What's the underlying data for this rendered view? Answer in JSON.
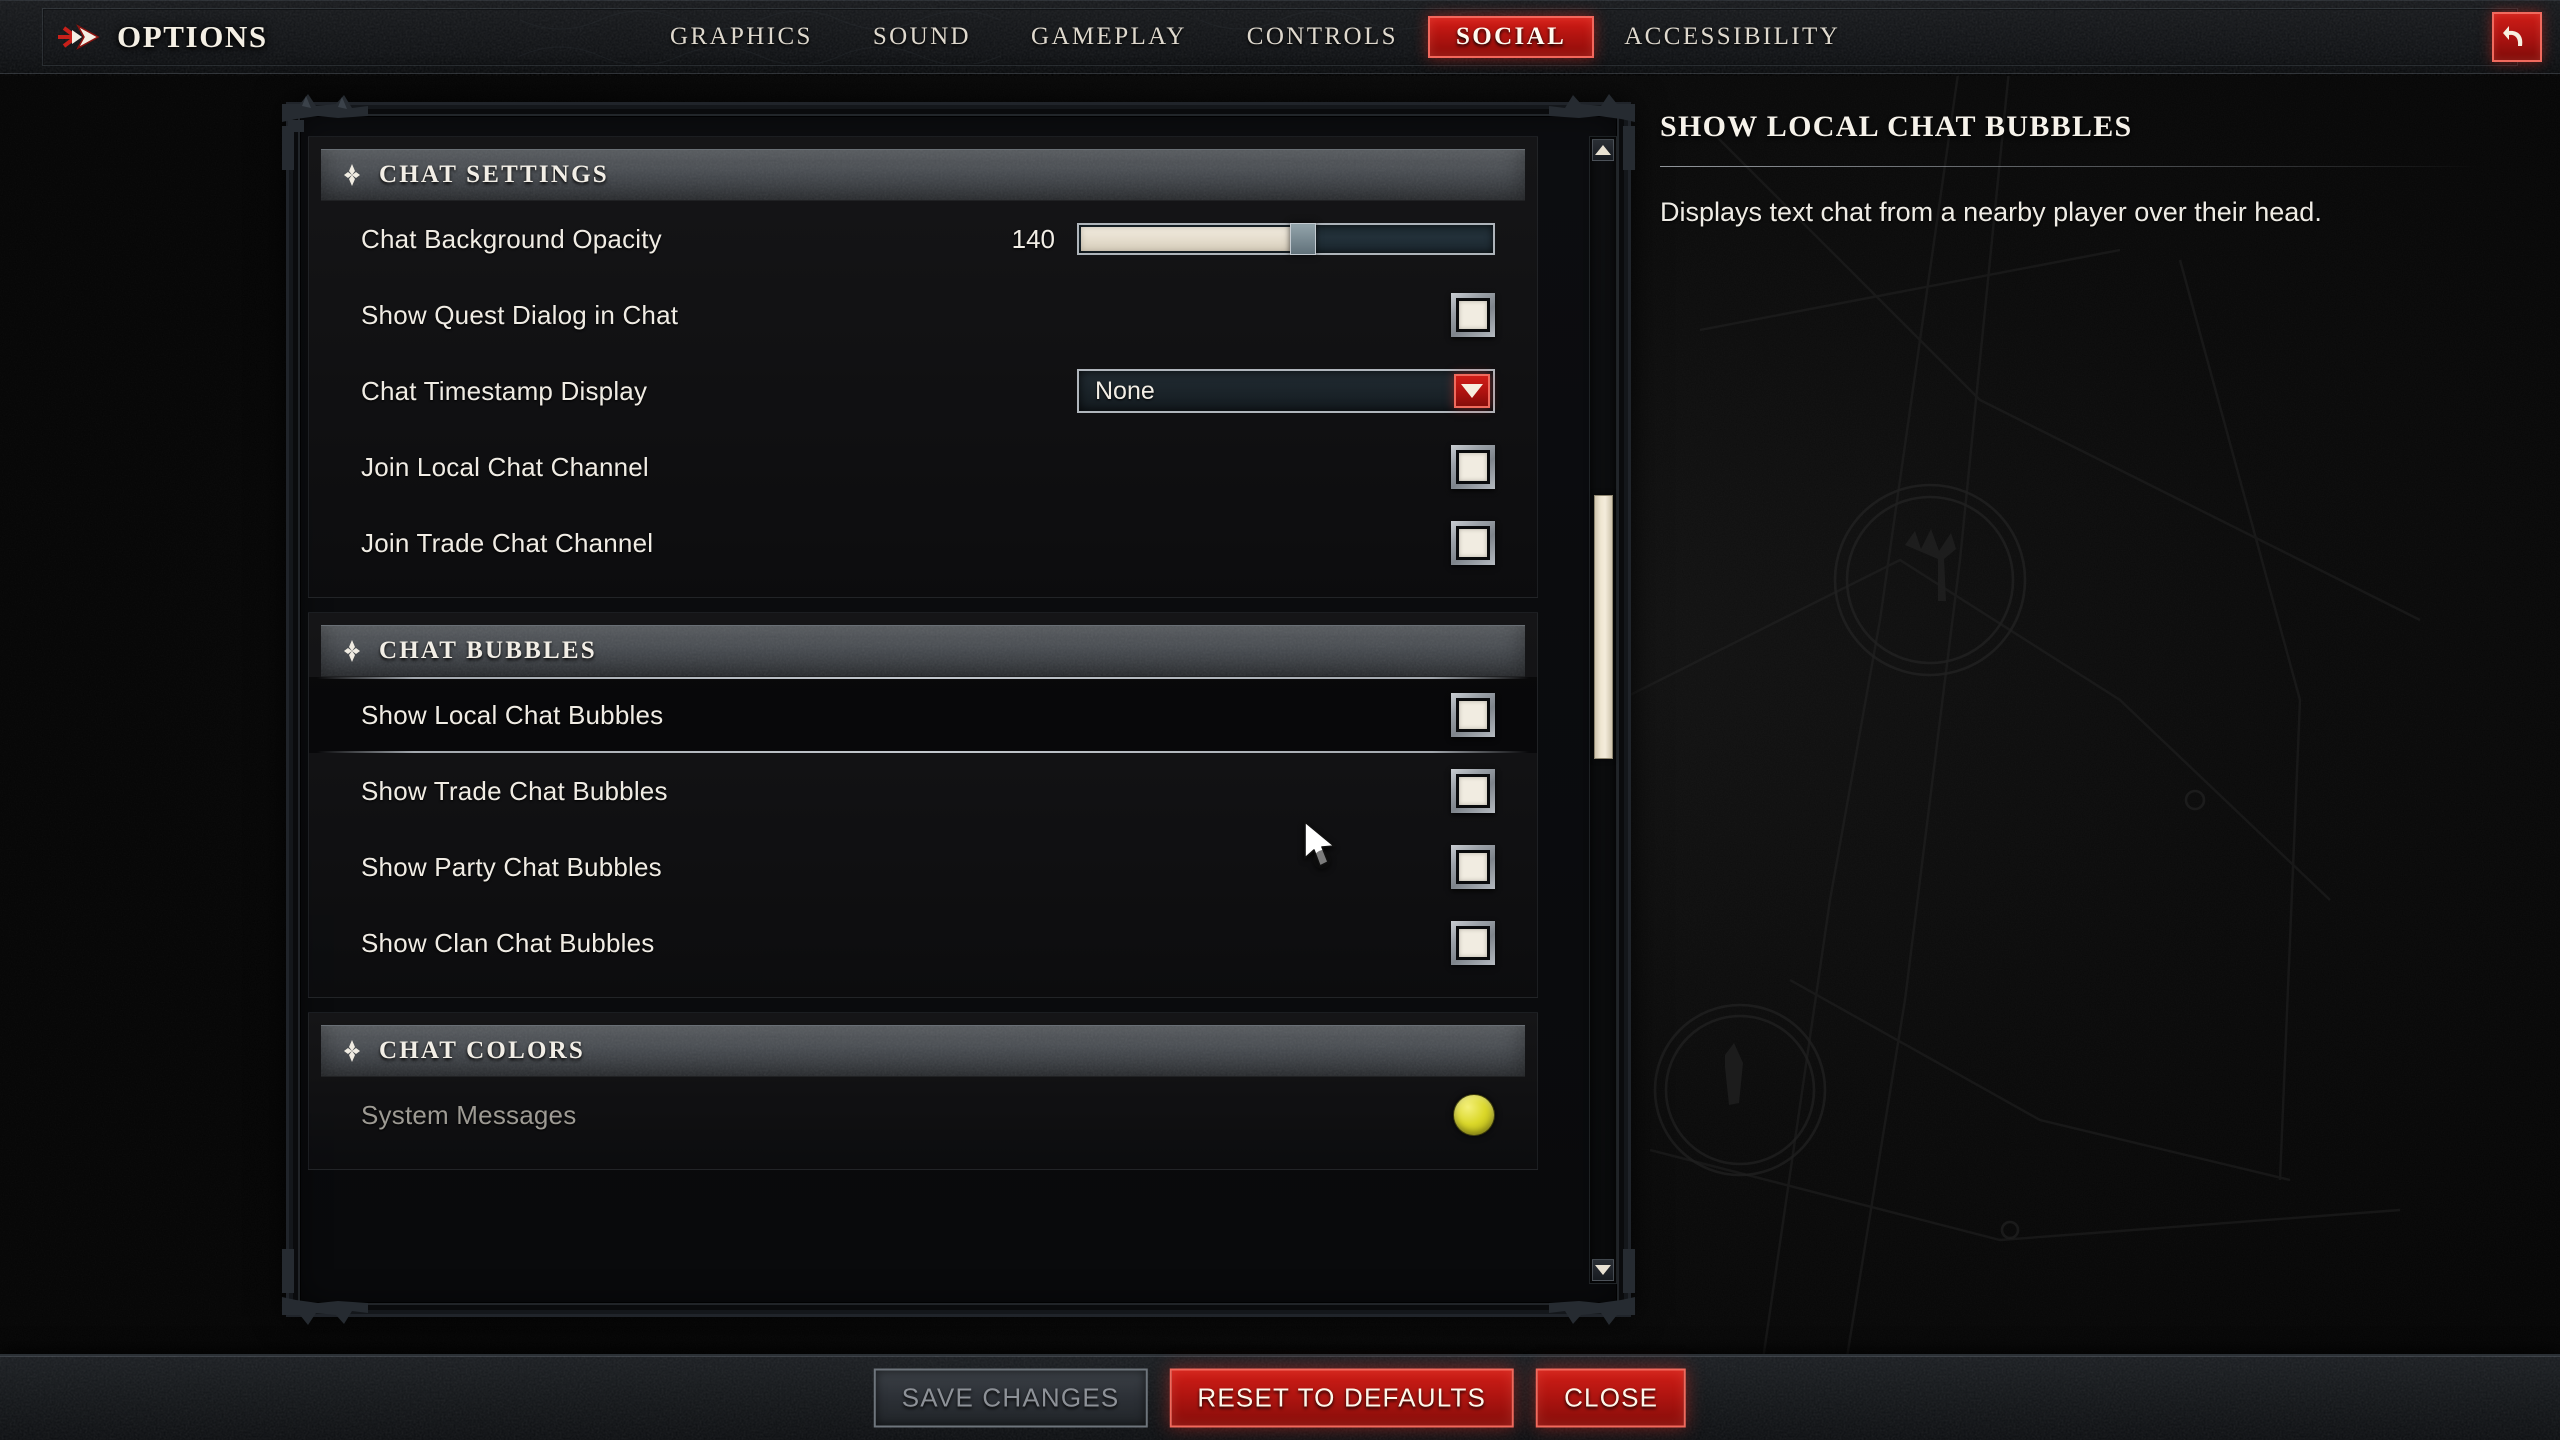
{
  "header": {
    "title": "OPTIONS",
    "brand_icon": "double-arrow-icon",
    "back_icon": "back-arrow-icon",
    "tabs": [
      {
        "label": "GRAPHICS",
        "active": false
      },
      {
        "label": "SOUND",
        "active": false
      },
      {
        "label": "GAMEPLAY",
        "active": false
      },
      {
        "label": "CONTROLS",
        "active": false
      },
      {
        "label": "SOCIAL",
        "active": true
      },
      {
        "label": "ACCESSIBILITY",
        "active": false
      }
    ],
    "active_tab": "SOCIAL",
    "active_tab_color": "#b31410"
  },
  "sections": [
    {
      "id": "chat-settings",
      "title": "CHAT SETTINGS",
      "rows": [
        {
          "label": "Chat Background Opacity",
          "control": "slider",
          "value": "140",
          "fill_percent": 54
        },
        {
          "label": "Show Quest Dialog in Chat",
          "control": "checkbox",
          "checked": true
        },
        {
          "label": "Chat Timestamp Display",
          "control": "dropdown",
          "value": "None"
        },
        {
          "label": "Join Local Chat Channel",
          "control": "checkbox",
          "checked": true
        },
        {
          "label": "Join Trade Chat Channel",
          "control": "checkbox",
          "checked": true
        }
      ]
    },
    {
      "id": "chat-bubbles",
      "title": "CHAT BUBBLES",
      "rows": [
        {
          "label": "Show Local Chat Bubbles",
          "control": "checkbox",
          "checked": true,
          "hovered": true
        },
        {
          "label": "Show Trade Chat Bubbles",
          "control": "checkbox",
          "checked": true
        },
        {
          "label": "Show Party Chat Bubbles",
          "control": "checkbox",
          "checked": true
        },
        {
          "label": "Show Clan Chat Bubbles",
          "control": "checkbox",
          "checked": true
        }
      ]
    },
    {
      "id": "chat-colors",
      "title": "CHAT COLORS",
      "rows": [
        {
          "label": "System Messages",
          "control": "color",
          "dim": true,
          "color": "#dbd82a"
        }
      ]
    }
  ],
  "scrollbar": {
    "up_icon": "chevron-up-icon",
    "down_icon": "chevron-down-icon",
    "thumb_top_percent": 29,
    "thumb_height_percent": 23
  },
  "info_panel": {
    "title": "SHOW LOCAL CHAT BUBBLES",
    "description": "Displays text chat from a nearby player over their head."
  },
  "footer": {
    "buttons": [
      {
        "label": "SAVE CHANGES",
        "style": "disabled"
      },
      {
        "label": "RESET TO DEFAULTS",
        "style": "danger"
      },
      {
        "label": "CLOSE",
        "style": "danger"
      }
    ]
  },
  "cursor": {
    "icon": "mouse-pointer-icon"
  }
}
